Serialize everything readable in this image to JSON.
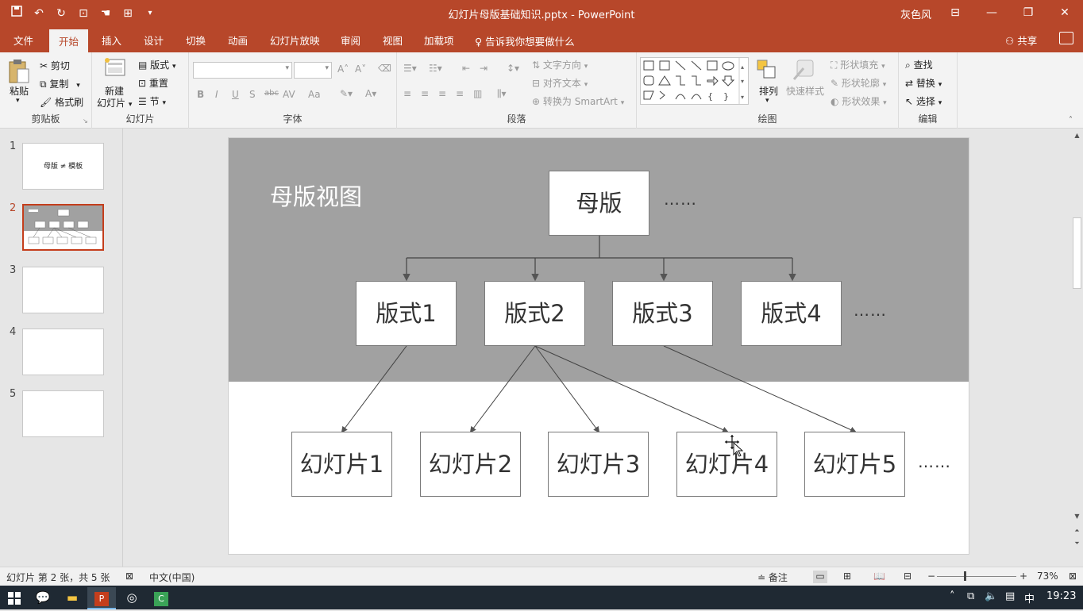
{
  "window": {
    "title": "幻灯片母版基础知识.pptx - PowerPoint",
    "user": "灰色风",
    "controls": [
      "ribbon-display-icon",
      "minimize-icon",
      "restore-icon",
      "close-icon"
    ]
  },
  "qat": [
    "save-icon",
    "undo-icon",
    "redo-icon",
    "start-from-beginning-icon",
    "touch-mode-icon",
    "print-preview-icon",
    "customize-qat-icon"
  ],
  "tabs": {
    "file": "文件",
    "home": "开始",
    "insert": "插入",
    "design": "设计",
    "transitions": "切换",
    "animations": "动画",
    "slideshow": "幻灯片放映",
    "review": "审阅",
    "view": "视图",
    "addins": "加载项",
    "tellme": "告诉我你想要做什么",
    "share": "共享"
  },
  "ribbon": {
    "clipboard": {
      "label": "剪贴板",
      "paste": "粘贴",
      "cut": "剪切",
      "copy": "复制",
      "format_painter": "格式刷"
    },
    "slides": {
      "label": "幻灯片",
      "new_slide": "新建",
      "new_slide2": "幻灯片",
      "layout": "版式",
      "reset": "重置",
      "section": "节"
    },
    "font": {
      "label": "字体",
      "bold": "B",
      "italic": "I",
      "underline": "U",
      "shadow": "S",
      "strike": "abc",
      "spacing": "AV",
      "case": "Aa"
    },
    "paragraph": {
      "label": "段落",
      "text_direction": "文字方向",
      "align_text": "对齐文本",
      "smartart": "转换为 SmartArt"
    },
    "drawing": {
      "label": "绘图",
      "arrange": "排列",
      "quick_styles": "快速样式",
      "shape_fill": "形状填充",
      "shape_outline": "形状轮廓",
      "shape_effects": "形状效果"
    },
    "editing": {
      "label": "编辑",
      "find": "查找",
      "replace": "替换",
      "select": "选择"
    }
  },
  "thumbnails": [
    {
      "num": "1",
      "text": "母版 ≠ 模板"
    },
    {
      "num": "2",
      "text": ""
    },
    {
      "num": "3",
      "text": ""
    },
    {
      "num": "4",
      "text": ""
    },
    {
      "num": "5",
      "text": ""
    }
  ],
  "slide": {
    "heading": "母版视图",
    "master": "母版",
    "layouts": [
      "版式1",
      "版式2",
      "版式3",
      "版式4"
    ],
    "slides": [
      "幻灯片1",
      "幻灯片2",
      "幻灯片3",
      "幻灯片4",
      "幻灯片5"
    ],
    "ellipsis": "……",
    "band_color": "#a1a1a1"
  },
  "status": {
    "slide_info": "幻灯片 第 2 张，共 5 张",
    "language": "中文(中国)",
    "notes": "备注",
    "zoom_minus": "−",
    "zoom_plus": "+",
    "zoom": "73%"
  },
  "taskbar": {
    "time": "19:23",
    "ime": "中"
  },
  "colors": {
    "accent": "#b7472a"
  }
}
